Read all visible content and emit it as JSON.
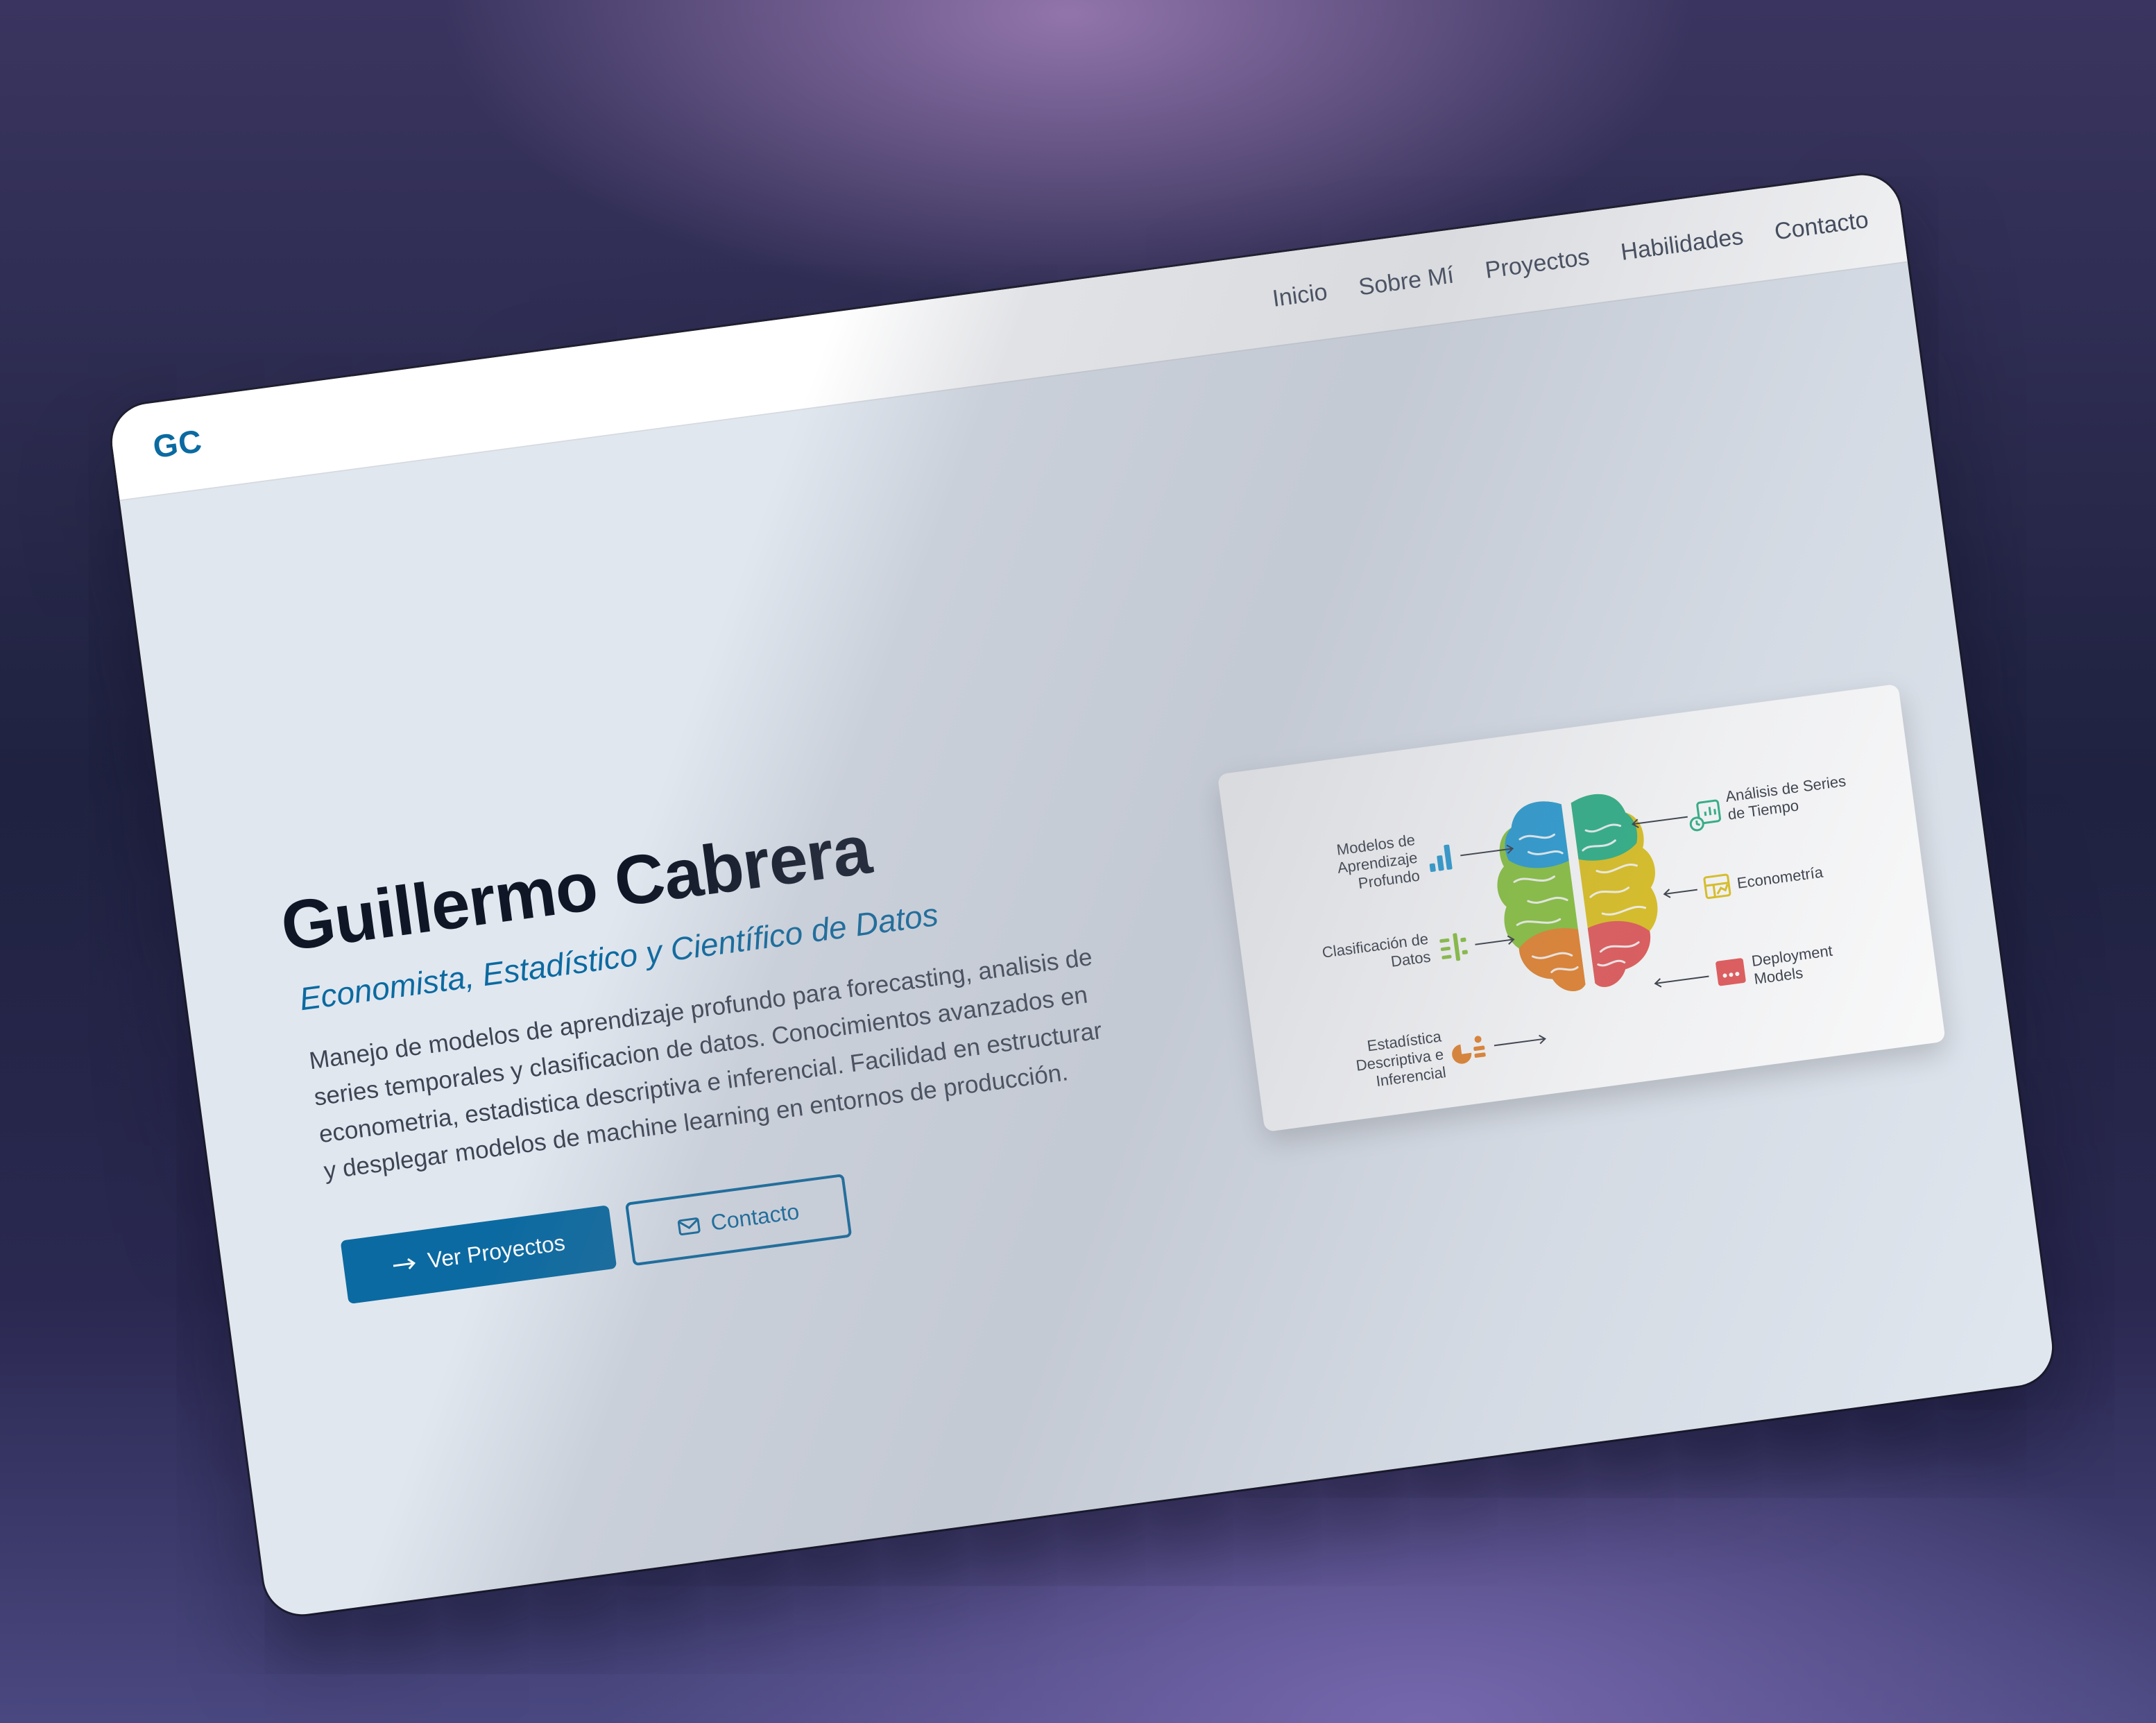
{
  "logo": "GC",
  "nav": {
    "items": [
      "Inicio",
      "Sobre Mí",
      "Proyectos",
      "Habilidades",
      "Contacto"
    ]
  },
  "hero": {
    "name": "Guillermo Cabrera",
    "role": "Economista, Estadístico y Científico de Datos",
    "description": "Manejo de modelos de aprendizaje profundo para forecasting, analisis de series temporales y clasificacion de datos. Conocimientos avanzados en econometria, estadistica descriptiva e inferencial. Facilidad en estructurar y desplegar modelos de machine learning en entornos de producción.",
    "primary_button": "Ver Proyectos",
    "secondary_button": "Contacto"
  },
  "diagram": {
    "left_labels": [
      [
        "Modelos de",
        "Aprendizaje",
        "Profundo"
      ],
      [
        "Clasificación de",
        "Datos"
      ],
      [
        "Estadística",
        "Descriptiva e",
        "Inferencial"
      ]
    ],
    "right_labels": [
      [
        "Análisis de Series",
        "de Tiempo"
      ],
      [
        "Econometría"
      ],
      [
        "Deployment",
        "Models"
      ]
    ]
  },
  "colors": {
    "accent": "#0b6aa1",
    "brain_blue": "#2a9fd6",
    "brain_teal": "#2fb388",
    "brain_green": "#8cc63f",
    "brain_yellow": "#e1c521",
    "brain_orange": "#e8852f",
    "brain_red": "#e65b5b"
  },
  "icons": {
    "primary_button": "arrow-right-icon",
    "secondary_button": "mail-icon",
    "diagram": [
      "bar-chart-icon",
      "classification-icon",
      "statistics-icon",
      "time-series-icon",
      "econometrics-icon",
      "deployment-icon"
    ]
  }
}
